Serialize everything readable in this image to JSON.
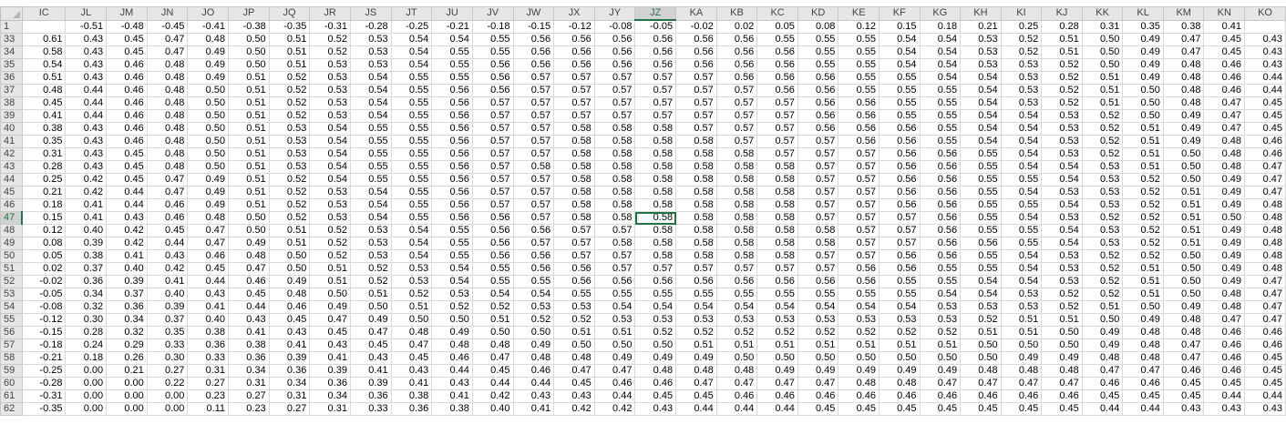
{
  "columns": [
    "IC",
    "JL",
    "JM",
    "JN",
    "JO",
    "JP",
    "JQ",
    "JR",
    "JS",
    "JT",
    "JU",
    "JV",
    "JW",
    "JX",
    "JY",
    "JZ",
    "KA",
    "KB",
    "KC",
    "KD",
    "KE",
    "KF",
    "KG",
    "KH",
    "KI",
    "KJ",
    "KK",
    "KL",
    "KM",
    "KN",
    "KO"
  ],
  "active_column": "JZ",
  "active_row": "47",
  "active_cell_value": "0.58",
  "rows": [
    {
      "h": "1",
      "c": [
        "",
        "-0.51",
        "-0.48",
        "-0.45",
        "-0.41",
        "-0.38",
        "-0.35",
        "-0.31",
        "-0.28",
        "-0.25",
        "-0.21",
        "-0.18",
        "-0.15",
        "-0.12",
        "-0.08",
        "-0.05",
        "-0.02",
        "0.02",
        "0.05",
        "0.08",
        "0.12",
        "0.15",
        "0.18",
        "0.21",
        "0.25",
        "0.28",
        "0.31",
        "0.35",
        "0.38",
        "0.41",
        ""
      ]
    },
    {
      "h": "33",
      "c": [
        "0.61",
        "0.43",
        "0.45",
        "0.47",
        "0.48",
        "0.50",
        "0.51",
        "0.52",
        "0.53",
        "0.54",
        "0.54",
        "0.55",
        "0.56",
        "0.56",
        "0.56",
        "0.56",
        "0.56",
        "0.56",
        "0.55",
        "0.55",
        "0.55",
        "0.54",
        "0.54",
        "0.53",
        "0.52",
        "0.51",
        "0.50",
        "0.49",
        "0.47",
        "0.45",
        "0.43"
      ]
    },
    {
      "h": "34",
      "c": [
        "0.58",
        "0.43",
        "0.45",
        "0.47",
        "0.49",
        "0.50",
        "0.51",
        "0.52",
        "0.53",
        "0.54",
        "0.55",
        "0.55",
        "0.56",
        "0.56",
        "0.56",
        "0.56",
        "0.56",
        "0.56",
        "0.56",
        "0.55",
        "0.55",
        "0.54",
        "0.54",
        "0.53",
        "0.52",
        "0.51",
        "0.50",
        "0.49",
        "0.47",
        "0.45",
        "0.43"
      ]
    },
    {
      "h": "35",
      "c": [
        "0.54",
        "0.43",
        "0.46",
        "0.48",
        "0.49",
        "0.50",
        "0.51",
        "0.53",
        "0.53",
        "0.54",
        "0.55",
        "0.56",
        "0.56",
        "0.56",
        "0.56",
        "0.56",
        "0.56",
        "0.56",
        "0.56",
        "0.55",
        "0.55",
        "0.54",
        "0.54",
        "0.53",
        "0.53",
        "0.52",
        "0.50",
        "0.49",
        "0.48",
        "0.46",
        "0.43"
      ]
    },
    {
      "h": "36",
      "c": [
        "0.51",
        "0.43",
        "0.46",
        "0.48",
        "0.49",
        "0.51",
        "0.52",
        "0.53",
        "0.54",
        "0.55",
        "0.55",
        "0.56",
        "0.57",
        "0.57",
        "0.57",
        "0.57",
        "0.57",
        "0.56",
        "0.56",
        "0.56",
        "0.55",
        "0.55",
        "0.54",
        "0.54",
        "0.53",
        "0.52",
        "0.51",
        "0.49",
        "0.48",
        "0.46",
        "0.44"
      ]
    },
    {
      "h": "37",
      "c": [
        "0.48",
        "0.44",
        "0.46",
        "0.48",
        "0.50",
        "0.51",
        "0.52",
        "0.53",
        "0.54",
        "0.55",
        "0.56",
        "0.56",
        "0.57",
        "0.57",
        "0.57",
        "0.57",
        "0.57",
        "0.57",
        "0.56",
        "0.56",
        "0.55",
        "0.55",
        "0.55",
        "0.54",
        "0.53",
        "0.52",
        "0.51",
        "0.50",
        "0.48",
        "0.46",
        "0.44"
      ]
    },
    {
      "h": "38",
      "c": [
        "0.45",
        "0.44",
        "0.46",
        "0.48",
        "0.50",
        "0.51",
        "0.52",
        "0.53",
        "0.54",
        "0.55",
        "0.56",
        "0.57",
        "0.57",
        "0.57",
        "0.57",
        "0.57",
        "0.57",
        "0.57",
        "0.57",
        "0.56",
        "0.56",
        "0.55",
        "0.55",
        "0.54",
        "0.53",
        "0.52",
        "0.51",
        "0.50",
        "0.48",
        "0.47",
        "0.45"
      ]
    },
    {
      "h": "39",
      "c": [
        "0.41",
        "0.44",
        "0.46",
        "0.48",
        "0.50",
        "0.51",
        "0.52",
        "0.53",
        "0.54",
        "0.55",
        "0.56",
        "0.57",
        "0.57",
        "0.57",
        "0.57",
        "0.57",
        "0.57",
        "0.57",
        "0.57",
        "0.56",
        "0.56",
        "0.55",
        "0.55",
        "0.54",
        "0.54",
        "0.53",
        "0.52",
        "0.50",
        "0.49",
        "0.47",
        "0.45"
      ]
    },
    {
      "h": "40",
      "c": [
        "0.38",
        "0.43",
        "0.46",
        "0.48",
        "0.50",
        "0.51",
        "0.53",
        "0.54",
        "0.55",
        "0.55",
        "0.56",
        "0.57",
        "0.57",
        "0.58",
        "0.58",
        "0.58",
        "0.57",
        "0.57",
        "0.57",
        "0.56",
        "0.56",
        "0.56",
        "0.55",
        "0.54",
        "0.54",
        "0.53",
        "0.52",
        "0.51",
        "0.49",
        "0.47",
        "0.45"
      ]
    },
    {
      "h": "41",
      "c": [
        "0.35",
        "0.43",
        "0.46",
        "0.48",
        "0.50",
        "0.51",
        "0.53",
        "0.54",
        "0.55",
        "0.55",
        "0.56",
        "0.57",
        "0.57",
        "0.58",
        "0.58",
        "0.58",
        "0.58",
        "0.57",
        "0.57",
        "0.57",
        "0.56",
        "0.56",
        "0.55",
        "0.54",
        "0.54",
        "0.53",
        "0.52",
        "0.51",
        "0.49",
        "0.48",
        "0.46"
      ]
    },
    {
      "h": "42",
      "c": [
        "0.31",
        "0.43",
        "0.45",
        "0.48",
        "0.50",
        "0.51",
        "0.53",
        "0.54",
        "0.55",
        "0.55",
        "0.56",
        "0.57",
        "0.57",
        "0.58",
        "0.58",
        "0.58",
        "0.58",
        "0.58",
        "0.57",
        "0.57",
        "0.57",
        "0.56",
        "0.56",
        "0.55",
        "0.54",
        "0.53",
        "0.52",
        "0.51",
        "0.50",
        "0.48",
        "0.46"
      ]
    },
    {
      "h": "43",
      "c": [
        "0.28",
        "0.43",
        "0.45",
        "0.48",
        "0.50",
        "0.51",
        "0.53",
        "0.54",
        "0.55",
        "0.55",
        "0.56",
        "0.57",
        "0.58",
        "0.58",
        "0.58",
        "0.58",
        "0.58",
        "0.58",
        "0.58",
        "0.57",
        "0.57",
        "0.56",
        "0.56",
        "0.55",
        "0.54",
        "0.54",
        "0.53",
        "0.51",
        "0.50",
        "0.48",
        "0.47"
      ]
    },
    {
      "h": "44",
      "c": [
        "0.25",
        "0.42",
        "0.45",
        "0.47",
        "0.49",
        "0.51",
        "0.52",
        "0.54",
        "0.55",
        "0.55",
        "0.56",
        "0.57",
        "0.57",
        "0.58",
        "0.58",
        "0.58",
        "0.58",
        "0.58",
        "0.58",
        "0.57",
        "0.57",
        "0.56",
        "0.56",
        "0.55",
        "0.55",
        "0.54",
        "0.53",
        "0.52",
        "0.50",
        "0.49",
        "0.47"
      ]
    },
    {
      "h": "45",
      "c": [
        "0.21",
        "0.42",
        "0.44",
        "0.47",
        "0.49",
        "0.51",
        "0.52",
        "0.53",
        "0.54",
        "0.55",
        "0.56",
        "0.57",
        "0.57",
        "0.58",
        "0.58",
        "0.58",
        "0.58",
        "0.58",
        "0.58",
        "0.57",
        "0.57",
        "0.56",
        "0.56",
        "0.55",
        "0.54",
        "0.53",
        "0.53",
        "0.52",
        "0.51",
        "0.49",
        "0.47"
      ]
    },
    {
      "h": "46",
      "c": [
        "0.18",
        "0.41",
        "0.44",
        "0.46",
        "0.49",
        "0.51",
        "0.52",
        "0.53",
        "0.54",
        "0.55",
        "0.56",
        "0.57",
        "0.57",
        "0.58",
        "0.58",
        "0.58",
        "0.58",
        "0.58",
        "0.58",
        "0.57",
        "0.57",
        "0.56",
        "0.56",
        "0.55",
        "0.55",
        "0.54",
        "0.53",
        "0.52",
        "0.51",
        "0.49",
        "0.48"
      ]
    },
    {
      "h": "47",
      "c": [
        "0.15",
        "0.41",
        "0.43",
        "0.46",
        "0.48",
        "0.50",
        "0.52",
        "0.53",
        "0.54",
        "0.55",
        "0.56",
        "0.56",
        "0.57",
        "0.58",
        "0.58",
        "0.58",
        "0.58",
        "0.58",
        "0.58",
        "0.57",
        "0.57",
        "0.57",
        "0.56",
        "0.55",
        "0.54",
        "0.53",
        "0.52",
        "0.52",
        "0.51",
        "0.50",
        "0.48"
      ]
    },
    {
      "h": "48",
      "c": [
        "0.12",
        "0.40",
        "0.42",
        "0.45",
        "0.47",
        "0.50",
        "0.51",
        "0.52",
        "0.53",
        "0.54",
        "0.55",
        "0.56",
        "0.56",
        "0.57",
        "0.57",
        "0.58",
        "0.58",
        "0.58",
        "0.58",
        "0.58",
        "0.57",
        "0.57",
        "0.56",
        "0.55",
        "0.55",
        "0.54",
        "0.53",
        "0.52",
        "0.51",
        "0.49",
        "0.48"
      ]
    },
    {
      "h": "49",
      "c": [
        "0.08",
        "0.39",
        "0.42",
        "0.44",
        "0.47",
        "0.49",
        "0.51",
        "0.52",
        "0.53",
        "0.54",
        "0.55",
        "0.56",
        "0.57",
        "0.57",
        "0.58",
        "0.58",
        "0.58",
        "0.58",
        "0.58",
        "0.58",
        "0.57",
        "0.57",
        "0.56",
        "0.56",
        "0.55",
        "0.54",
        "0.53",
        "0.52",
        "0.51",
        "0.49",
        "0.48"
      ]
    },
    {
      "h": "50",
      "c": [
        "0.05",
        "0.38",
        "0.41",
        "0.43",
        "0.46",
        "0.48",
        "0.50",
        "0.52",
        "0.53",
        "0.54",
        "0.55",
        "0.56",
        "0.56",
        "0.57",
        "0.57",
        "0.58",
        "0.58",
        "0.58",
        "0.58",
        "0.57",
        "0.57",
        "0.56",
        "0.56",
        "0.55",
        "0.54",
        "0.53",
        "0.52",
        "0.52",
        "0.50",
        "0.49",
        "0.48"
      ]
    },
    {
      "h": "51",
      "c": [
        "0.02",
        "0.37",
        "0.40",
        "0.42",
        "0.45",
        "0.47",
        "0.50",
        "0.51",
        "0.52",
        "0.53",
        "0.54",
        "0.55",
        "0.56",
        "0.56",
        "0.57",
        "0.57",
        "0.57",
        "0.57",
        "0.57",
        "0.57",
        "0.56",
        "0.56",
        "0.55",
        "0.55",
        "0.54",
        "0.53",
        "0.52",
        "0.51",
        "0.50",
        "0.49",
        "0.48"
      ]
    },
    {
      "h": "52",
      "c": [
        "-0.02",
        "0.36",
        "0.39",
        "0.41",
        "0.44",
        "0.46",
        "0.49",
        "0.51",
        "0.52",
        "0.53",
        "0.54",
        "0.55",
        "0.55",
        "0.56",
        "0.56",
        "0.56",
        "0.56",
        "0.56",
        "0.56",
        "0.56",
        "0.56",
        "0.55",
        "0.55",
        "0.54",
        "0.54",
        "0.53",
        "0.52",
        "0.51",
        "0.50",
        "0.49",
        "0.47"
      ]
    },
    {
      "h": "53",
      "c": [
        "-0.05",
        "0.34",
        "0.37",
        "0.40",
        "0.43",
        "0.45",
        "0.48",
        "0.50",
        "0.51",
        "0.52",
        "0.53",
        "0.54",
        "0.54",
        "0.55",
        "0.55",
        "0.55",
        "0.55",
        "0.55",
        "0.55",
        "0.55",
        "0.55",
        "0.55",
        "0.54",
        "0.54",
        "0.53",
        "0.52",
        "0.52",
        "0.51",
        "0.50",
        "0.48",
        "0.47"
      ]
    },
    {
      "h": "54",
      "c": [
        "-0.08",
        "0.32",
        "0.36",
        "0.39",
        "0.41",
        "0.44",
        "0.46",
        "0.49",
        "0.50",
        "0.51",
        "0.52",
        "0.52",
        "0.53",
        "0.53",
        "0.54",
        "0.54",
        "0.54",
        "0.54",
        "0.54",
        "0.54",
        "0.54",
        "0.54",
        "0.53",
        "0.53",
        "0.53",
        "0.52",
        "0.51",
        "0.50",
        "0.49",
        "0.48",
        "0.47"
      ]
    },
    {
      "h": "55",
      "c": [
        "-0.12",
        "0.30",
        "0.34",
        "0.37",
        "0.40",
        "0.43",
        "0.45",
        "0.47",
        "0.49",
        "0.50",
        "0.50",
        "0.51",
        "0.52",
        "0.52",
        "0.53",
        "0.53",
        "0.53",
        "0.53",
        "0.53",
        "0.53",
        "0.53",
        "0.53",
        "0.53",
        "0.52",
        "0.51",
        "0.51",
        "0.50",
        "0.49",
        "0.48",
        "0.47",
        "0.47"
      ]
    },
    {
      "h": "56",
      "c": [
        "-0.15",
        "0.28",
        "0.32",
        "0.35",
        "0.38",
        "0.41",
        "0.43",
        "0.45",
        "0.47",
        "0.48",
        "0.49",
        "0.50",
        "0.50",
        "0.51",
        "0.51",
        "0.52",
        "0.52",
        "0.52",
        "0.52",
        "0.52",
        "0.52",
        "0.52",
        "0.52",
        "0.51",
        "0.51",
        "0.50",
        "0.49",
        "0.48",
        "0.48",
        "0.46",
        "0.46"
      ]
    },
    {
      "h": "57",
      "c": [
        "-0.18",
        "0.24",
        "0.29",
        "0.33",
        "0.36",
        "0.38",
        "0.41",
        "0.43",
        "0.45",
        "0.47",
        "0.48",
        "0.48",
        "0.49",
        "0.50",
        "0.50",
        "0.50",
        "0.51",
        "0.51",
        "0.51",
        "0.51",
        "0.51",
        "0.51",
        "0.51",
        "0.50",
        "0.50",
        "0.50",
        "0.49",
        "0.48",
        "0.47",
        "0.46",
        "0.46"
      ]
    },
    {
      "h": "58",
      "c": [
        "-0.21",
        "0.18",
        "0.26",
        "0.30",
        "0.33",
        "0.36",
        "0.39",
        "0.41",
        "0.43",
        "0.45",
        "0.46",
        "0.47",
        "0.48",
        "0.48",
        "0.49",
        "0.49",
        "0.49",
        "0.50",
        "0.50",
        "0.50",
        "0.50",
        "0.50",
        "0.50",
        "0.50",
        "0.49",
        "0.49",
        "0.48",
        "0.48",
        "0.47",
        "0.46",
        "0.45"
      ]
    },
    {
      "h": "59",
      "c": [
        "-0.25",
        "0.00",
        "0.21",
        "0.27",
        "0.31",
        "0.34",
        "0.36",
        "0.39",
        "0.41",
        "0.43",
        "0.44",
        "0.45",
        "0.46",
        "0.47",
        "0.47",
        "0.48",
        "0.48",
        "0.48",
        "0.49",
        "0.49",
        "0.49",
        "0.49",
        "0.49",
        "0.48",
        "0.48",
        "0.48",
        "0.47",
        "0.47",
        "0.46",
        "0.46",
        "0.45"
      ]
    },
    {
      "h": "60",
      "c": [
        "-0.28",
        "0.00",
        "0.00",
        "0.22",
        "0.27",
        "0.31",
        "0.34",
        "0.36",
        "0.39",
        "0.41",
        "0.43",
        "0.44",
        "0.44",
        "0.45",
        "0.46",
        "0.46",
        "0.47",
        "0.47",
        "0.47",
        "0.47",
        "0.48",
        "0.48",
        "0.47",
        "0.47",
        "0.47",
        "0.47",
        "0.46",
        "0.46",
        "0.45",
        "0.45",
        "0.45"
      ]
    },
    {
      "h": "61",
      "c": [
        "-0.31",
        "0.00",
        "0.00",
        "0.00",
        "0.23",
        "0.27",
        "0.31",
        "0.34",
        "0.36",
        "0.38",
        "0.41",
        "0.42",
        "0.43",
        "0.43",
        "0.44",
        "0.45",
        "0.45",
        "0.46",
        "0.46",
        "0.46",
        "0.46",
        "0.46",
        "0.46",
        "0.46",
        "0.46",
        "0.46",
        "0.45",
        "0.45",
        "0.45",
        "0.44",
        "0.44"
      ]
    },
    {
      "h": "62",
      "c": [
        "-0.35",
        "0.00",
        "0.00",
        "0.00",
        "0.11",
        "0.23",
        "0.27",
        "0.31",
        "0.33",
        "0.36",
        "0.38",
        "0.40",
        "0.41",
        "0.42",
        "0.42",
        "0.43",
        "0.44",
        "0.44",
        "0.44",
        "0.45",
        "0.45",
        "0.45",
        "0.45",
        "0.45",
        "0.45",
        "0.45",
        "0.44",
        "0.44",
        "0.43",
        "0.43",
        "0.43"
      ]
    }
  ]
}
